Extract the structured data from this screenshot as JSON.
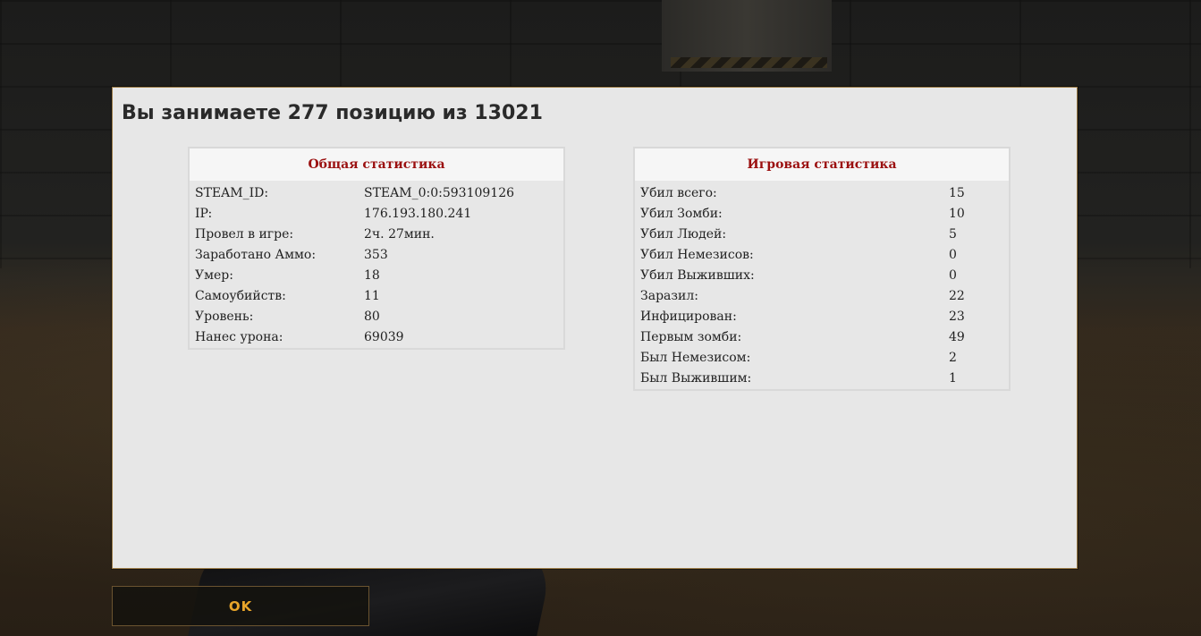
{
  "dialog": {
    "title": "Вы занимаете 277 позицию из 13021"
  },
  "general_stats": {
    "header": "Общая статистика",
    "rows": [
      {
        "label": "STEAM_ID:",
        "value": "STEAM_0:0:593109126"
      },
      {
        "label": "IP:",
        "value": "176.193.180.241"
      },
      {
        "label": "Провел в игре:",
        "value": "2ч. 27мин."
      },
      {
        "label": "Заработано Аммо:",
        "value": "353"
      },
      {
        "label": "Умер:",
        "value": "18"
      },
      {
        "label": "Самоубийств:",
        "value": "11"
      },
      {
        "label": "Уровень:",
        "value": "80"
      },
      {
        "label": "Нанес урона:",
        "value": "69039"
      }
    ]
  },
  "game_stats": {
    "header": "Игровая статистика",
    "rows": [
      {
        "label": "Убил всего:",
        "value": "15"
      },
      {
        "label": "Убил Зомби:",
        "value": "10"
      },
      {
        "label": "Убил Людей:",
        "value": "5"
      },
      {
        "label": "Убил Немезисов:",
        "value": "0"
      },
      {
        "label": "Убил Выживших:",
        "value": "0"
      },
      {
        "label": "Заразил:",
        "value": "22"
      },
      {
        "label": "Инфицирован:",
        "value": "23"
      },
      {
        "label": "Первым зомби:",
        "value": "49"
      },
      {
        "label": "Был Немезисом:",
        "value": "2"
      },
      {
        "label": "Был Выжившим:",
        "value": "1"
      }
    ]
  },
  "ok_button": {
    "label": "OK"
  },
  "colors": {
    "dialog_bg": "#e7e7e7",
    "header_text": "#9b1010",
    "button_text": "#e8a52a"
  }
}
